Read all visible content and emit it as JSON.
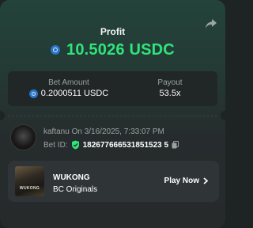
{
  "profit": {
    "label": "Profit",
    "value": "10.5026 USDC",
    "currency_icon": "usdc-icon"
  },
  "bet": {
    "amount_label": "Bet Amount",
    "amount_value": "0.2000511 USDC",
    "payout_label": "Payout",
    "payout_value": "53.5x"
  },
  "user": {
    "info": "kaftanu On 3/16/2025, 7:33:07 PM",
    "bet_id_label": "Bet ID:",
    "bet_id": "182677666531851523 5"
  },
  "game": {
    "title": "WUKONG",
    "provider": "BC Originals",
    "thumb_text": "WUKONG",
    "play_label": "Play Now"
  },
  "colors": {
    "profit_green": "#2fe47a",
    "usdc_blue": "#2775ca",
    "verified_green": "#2fe47a"
  }
}
